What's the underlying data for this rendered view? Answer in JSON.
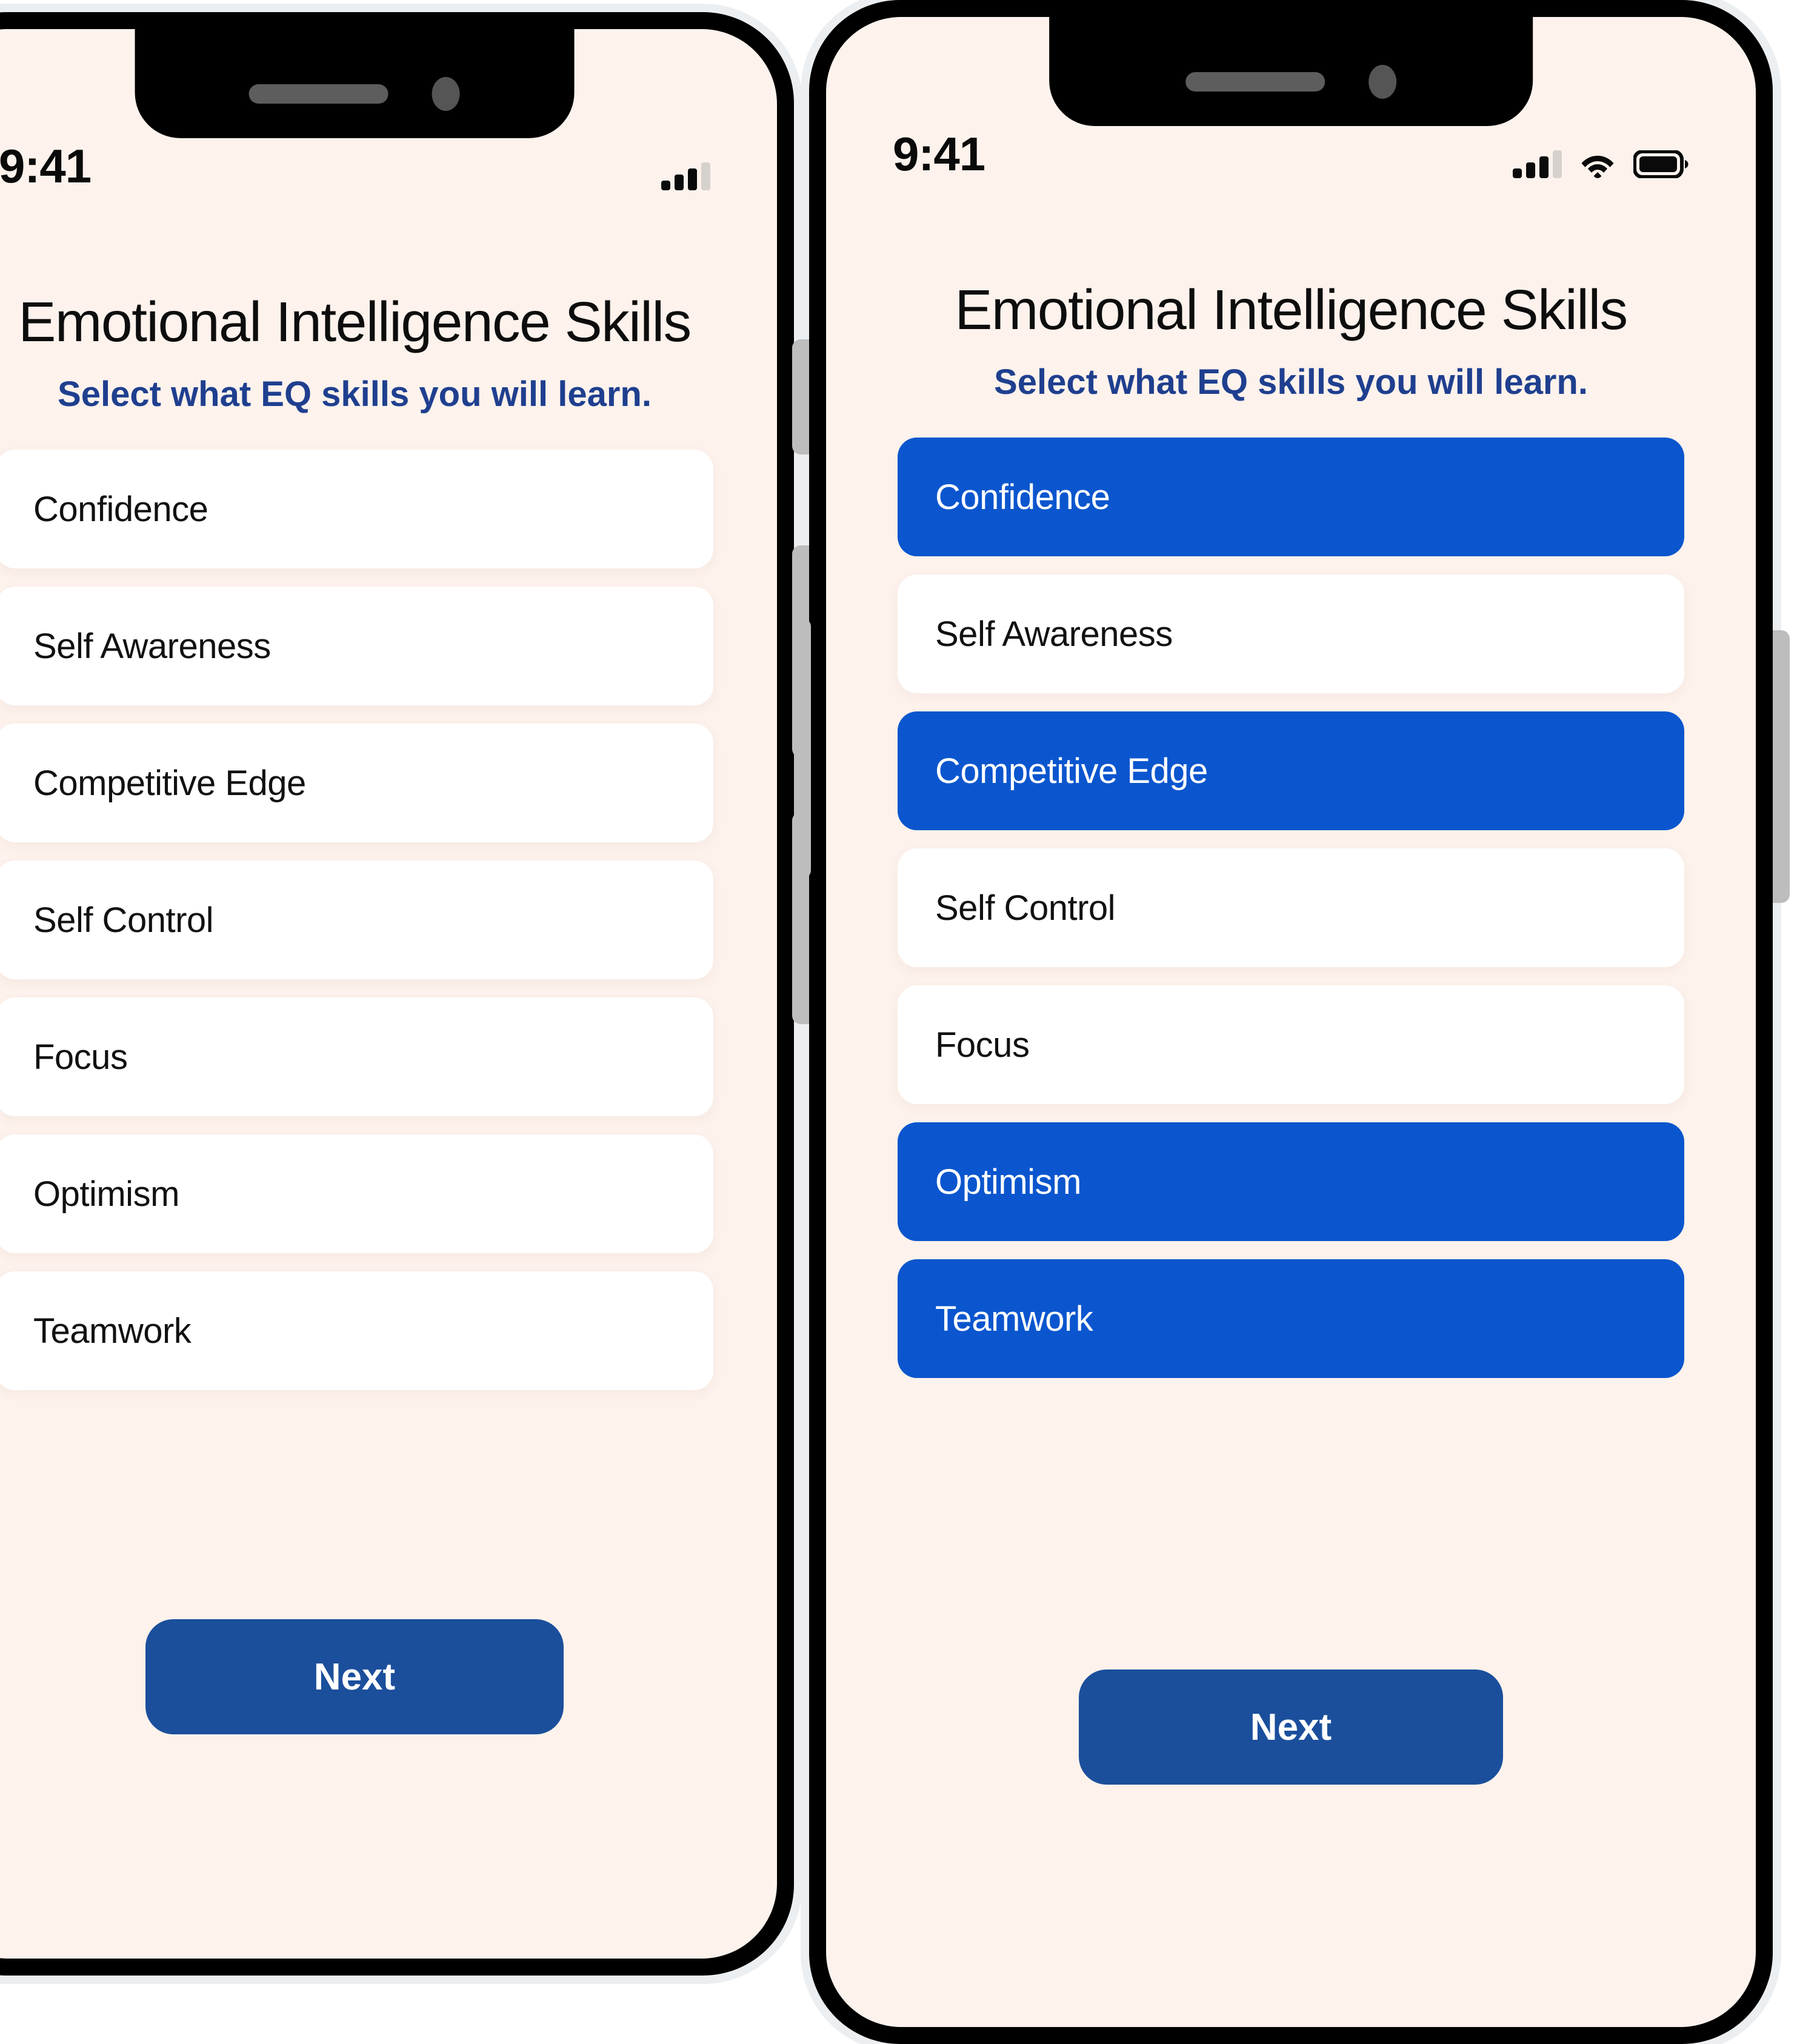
{
  "app": {
    "title": "Emotional Intelligence Skills",
    "subtitle": "Select what EQ skills you will learn.",
    "next_label": "Next"
  },
  "status_bar": {
    "time": "9:41",
    "icons": [
      "cellular-signal-icon",
      "wifi-icon",
      "battery-icon"
    ],
    "signal_bars_filled": 3,
    "signal_bars_total": 4,
    "battery_full": true
  },
  "colors": {
    "screen_background": "#fdf2ec",
    "selected_blue": "#0b56ce",
    "next_button_blue": "#1b4f9c",
    "subtitle_blue": "#1f3f8f",
    "card_white": "#ffffff",
    "device_black": "#000000",
    "device_outline": "#eceff1",
    "side_button_gray": "#bdbdbd",
    "page_background": "#ffffff"
  },
  "skills": [
    "Confidence",
    "Self Awareness",
    "Competitive Edge",
    "Self Control",
    "Focus",
    "Optimism",
    "Teamwork"
  ],
  "screens": [
    {
      "name": "unselected-state",
      "selected": [
        false,
        false,
        false,
        false,
        false,
        false,
        false
      ]
    },
    {
      "name": "selected-state",
      "selected": [
        true,
        false,
        true,
        false,
        false,
        true,
        true
      ]
    }
  ]
}
